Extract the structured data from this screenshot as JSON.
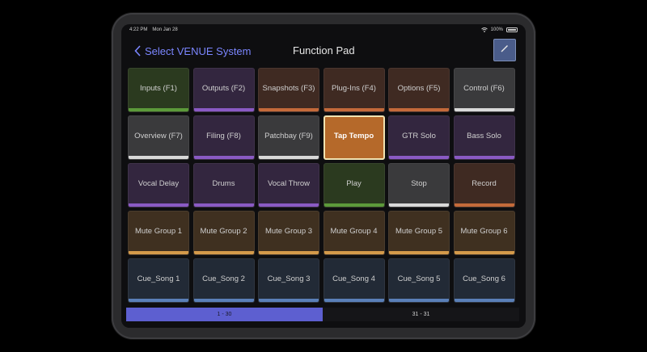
{
  "status": {
    "time": "4:22 PM",
    "date": "Mon Jan 28",
    "battery": "100%"
  },
  "nav": {
    "back_label": "Select VENUE System",
    "title": "Function Pad"
  },
  "pads": [
    {
      "label": "Inputs (F1)",
      "bg": "#2b3a1f",
      "strip": "#5c9a3a"
    },
    {
      "label": "Outputs (F2)",
      "bg": "#33263f",
      "strip": "#8a5ac4"
    },
    {
      "label": "Snapshots (F3)",
      "bg": "#3f2a22",
      "strip": "#c46a3a"
    },
    {
      "label": "Plug-Ins (F4)",
      "bg": "#3f2a22",
      "strip": "#c46a3a"
    },
    {
      "label": "Options (F5)",
      "bg": "#3f2a22",
      "strip": "#c46a3a"
    },
    {
      "label": "Control (F6)",
      "bg": "#3a3a3c",
      "strip": "#d8d8d8"
    },
    {
      "label": "Overview (F7)",
      "bg": "#3a3a3c",
      "strip": "#d8d8d8"
    },
    {
      "label": "Filing (F8)",
      "bg": "#33263f",
      "strip": "#8a5ac4"
    },
    {
      "label": "Patchbay (F9)",
      "bg": "#3a3a3c",
      "strip": "#d8d8d8"
    },
    {
      "label": "Tap Tempo",
      "bg": "#b5692a",
      "strip": "#b5692a",
      "selected": true
    },
    {
      "label": "GTR Solo",
      "bg": "#33263f",
      "strip": "#8a5ac4"
    },
    {
      "label": "Bass Solo",
      "bg": "#33263f",
      "strip": "#8a5ac4"
    },
    {
      "label": "Vocal Delay",
      "bg": "#33263f",
      "strip": "#8a5ac4"
    },
    {
      "label": "Drums",
      "bg": "#33263f",
      "strip": "#8a5ac4"
    },
    {
      "label": "Vocal Throw",
      "bg": "#33263f",
      "strip": "#8a5ac4"
    },
    {
      "label": "Play",
      "bg": "#2b3a1f",
      "strip": "#5c9a3a"
    },
    {
      "label": "Stop",
      "bg": "#3a3a3c",
      "strip": "#d8d8d8"
    },
    {
      "label": "Record",
      "bg": "#3f2a22",
      "strip": "#c46a3a"
    },
    {
      "label": "Mute Group 1",
      "bg": "#3f3020",
      "strip": "#d49a4a"
    },
    {
      "label": "Mute Group 2",
      "bg": "#3f3020",
      "strip": "#d49a4a"
    },
    {
      "label": "Mute Group 3",
      "bg": "#3f3020",
      "strip": "#d49a4a"
    },
    {
      "label": "Mute Group 4",
      "bg": "#3f3020",
      "strip": "#d49a4a"
    },
    {
      "label": "Mute Group 5",
      "bg": "#3f3020",
      "strip": "#d49a4a"
    },
    {
      "label": "Mute Group 6",
      "bg": "#3f3020",
      "strip": "#d49a4a"
    },
    {
      "label": "Cue_Song 1",
      "bg": "#222a36",
      "strip": "#5a7fb8"
    },
    {
      "label": "Cue_Song 2",
      "bg": "#222a36",
      "strip": "#5a7fb8"
    },
    {
      "label": "Cue_Song 3",
      "bg": "#222a36",
      "strip": "#5a7fb8"
    },
    {
      "label": "Cue_Song 4",
      "bg": "#222a36",
      "strip": "#5a7fb8"
    },
    {
      "label": "Cue_Song 5",
      "bg": "#222a36",
      "strip": "#5a7fb8"
    },
    {
      "label": "Cue_Song 6",
      "bg": "#222a36",
      "strip": "#5a7fb8"
    }
  ],
  "pages": [
    {
      "label": "1 - 30",
      "active": true
    },
    {
      "label": "31 - 31",
      "active": false
    }
  ],
  "colors": {
    "accent": "#7b86ff",
    "page_active": "#5d5fd0"
  }
}
